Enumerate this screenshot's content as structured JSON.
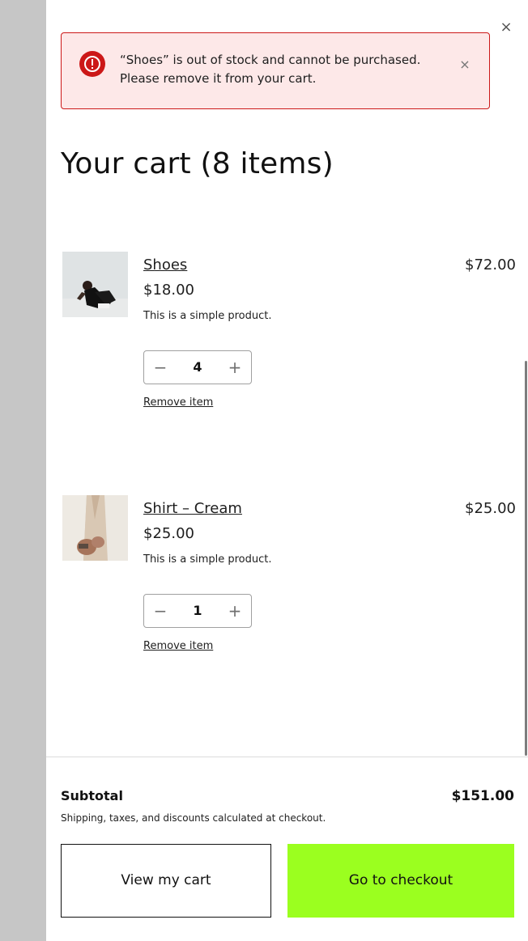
{
  "notice": {
    "line1": "“Shoes” is out of stock and cannot be purchased.",
    "line2": "Please remove it from your cart.",
    "icon": "error-circle-icon",
    "close_symbol": "×",
    "accent_color": "#cc1818",
    "background_color": "#fde8e8"
  },
  "drawer": {
    "close_symbol": "×"
  },
  "cart": {
    "title": "Your cart (8 items)",
    "items": [
      {
        "name": "Shoes",
        "price": "$18.00",
        "description": "This is a simple product.",
        "quantity": "4",
        "minus_symbol": "−",
        "plus_symbol": "+",
        "remove_label": "Remove item",
        "line_total": "$72.00",
        "image": "shoes-product-photo"
      },
      {
        "name": "Shirt – Cream",
        "price": "$25.00",
        "description": "This is a simple product.",
        "quantity": "1",
        "minus_symbol": "−",
        "plus_symbol": "+",
        "remove_label": "Remove item",
        "line_total": "$25.00",
        "image": "shirt-cream-product-photo"
      }
    ]
  },
  "footer": {
    "subtotal_label": "Subtotal",
    "subtotal_value": "$151.00",
    "note": "Shipping, taxes, and discounts calculated at checkout.",
    "view_cart_label": "View my cart",
    "checkout_label": "Go to checkout",
    "checkout_color": "#9bff1f"
  }
}
